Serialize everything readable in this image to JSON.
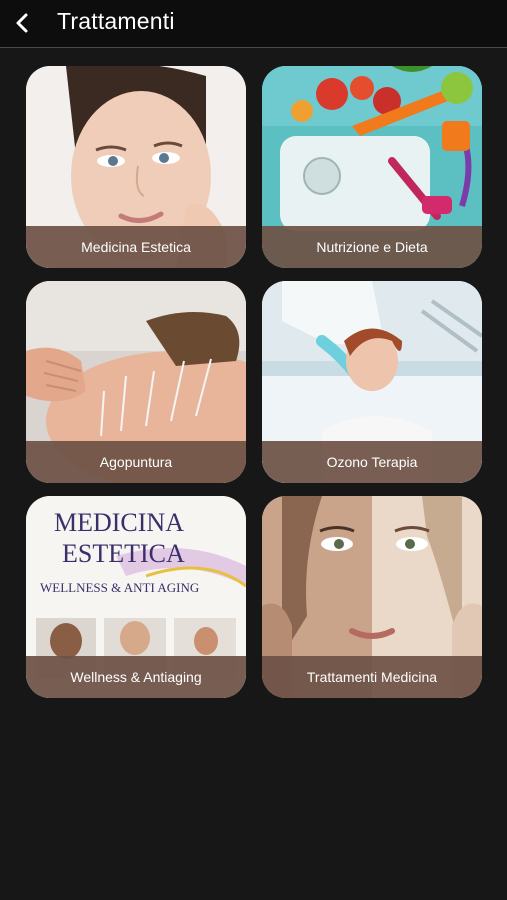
{
  "header": {
    "title": "Trattamenti",
    "back_icon": "chevron-left-icon"
  },
  "cards": [
    {
      "label": "Medicina Estetica"
    },
    {
      "label": "Nutrizione e Dieta"
    },
    {
      "label": "Agopuntura"
    },
    {
      "label": "Ozono Terapia"
    },
    {
      "label": "Wellness & Antiaging",
      "image_text": {
        "line1": "MEDICINA",
        "line2": "ESTETICA",
        "line3": "WELLNESS & ANTI AGING"
      }
    },
    {
      "label": "Trattamenti Medicina"
    }
  ],
  "colors": {
    "background": "#171717",
    "header_bg": "#0d0d0d",
    "caption_bg": "#6e5246"
  }
}
